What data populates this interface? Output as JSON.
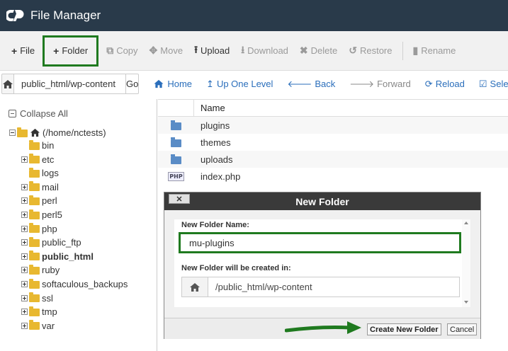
{
  "app": {
    "title": "File Manager",
    "logo_icon": "cpanel-logo-icon"
  },
  "colors": {
    "titlebar": "#293a4a",
    "highlight_green": "#1f7a1f",
    "link_blue": "#2a6ebb"
  },
  "toolbar": {
    "file": "File",
    "folder": "Folder",
    "copy": "Copy",
    "move": "Move",
    "upload": "Upload",
    "download": "Download",
    "delete": "Delete",
    "restore": "Restore",
    "rename": "Rename"
  },
  "navbar": {
    "path_value": "public_html/wp-content",
    "go": "Go",
    "home": "Home",
    "up_one_level": "Up One Level",
    "back": "Back",
    "forward": "Forward",
    "reload": "Reload",
    "select": "Select"
  },
  "sidebar": {
    "collapse_all": "Collapse All",
    "root": "(/home/nctests)",
    "items": [
      {
        "label": "bin",
        "expandable": false
      },
      {
        "label": "etc",
        "expandable": true
      },
      {
        "label": "logs",
        "expandable": false
      },
      {
        "label": "mail",
        "expandable": true
      },
      {
        "label": "perl",
        "expandable": true
      },
      {
        "label": "perl5",
        "expandable": true
      },
      {
        "label": "php",
        "expandable": true
      },
      {
        "label": "public_ftp",
        "expandable": true
      },
      {
        "label": "public_html",
        "expandable": true,
        "bold": true
      },
      {
        "label": "ruby",
        "expandable": true
      },
      {
        "label": "softaculous_backups",
        "expandable": true
      },
      {
        "label": "ssl",
        "expandable": true
      },
      {
        "label": "tmp",
        "expandable": true
      },
      {
        "label": "var",
        "expandable": true
      }
    ]
  },
  "filelist": {
    "column_name": "Name",
    "rows": [
      {
        "name": "plugins",
        "type": "folder"
      },
      {
        "name": "themes",
        "type": "folder"
      },
      {
        "name": "uploads",
        "type": "folder"
      },
      {
        "name": "index.php",
        "type": "php"
      }
    ]
  },
  "dialog": {
    "title": "New Folder",
    "close": "✕",
    "name_label": "New Folder Name:",
    "name_value": "mu-plugins",
    "location_label": "New Folder will be created in:",
    "location_value": "/public_html/wp-content",
    "create_button": "Create New Folder",
    "cancel_button": "Cancel"
  }
}
